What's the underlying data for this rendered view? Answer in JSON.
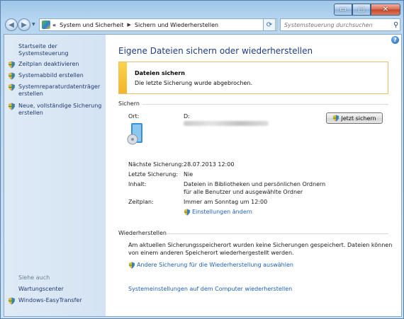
{
  "window": {
    "caption_buttons": {
      "minimize": "▭",
      "maximize": "▢",
      "close": "✕"
    }
  },
  "nav": {
    "breadcrumb": [
      "«",
      "System und Sicherheit",
      "Sichern und Wiederherstellen"
    ],
    "search_placeholder": "Systemsteuerung durchsuchen"
  },
  "sidebar": {
    "home_link": "Startseite der Systemsteuerung",
    "tasks": [
      {
        "label": "Zeitplan deaktivieren",
        "icon": "shield-icon"
      },
      {
        "label": "Systemabbild erstellen",
        "icon": "shield-icon"
      },
      {
        "label": "Systemreparaturdatenträger erstellen",
        "icon": "shield-icon"
      },
      {
        "label": "Neue, vollständige Sicherung erstellen",
        "icon": "shield-icon"
      }
    ],
    "see_also_heading": "Siehe auch",
    "see_also": [
      {
        "label": "Wartungscenter"
      },
      {
        "label": "Windows-EasyTransfer",
        "icon": "shield-icon"
      }
    ]
  },
  "main": {
    "title": "Eigene Dateien sichern oder wiederherstellen",
    "notice": {
      "heading": "Dateien sichern",
      "text": "Die letzte Sicherung wurde abgebrochen."
    },
    "backup": {
      "section": "Sichern",
      "location_label": "Ort:",
      "location_value": "D:",
      "backup_now_button": "Jetzt sichern",
      "next_label": "Nächste Sicherung:",
      "next_value": "28.07.2013 12:00",
      "last_label": "Letzte Sicherung:",
      "last_value": "Nie",
      "content_label": "Inhalt:",
      "content_value_line1": "Dateien in Bibliotheken und persönlichen Ordnern",
      "content_value_line2": "für alle Benutzer und ausgewählte Ordner",
      "schedule_label": "Zeitplan:",
      "schedule_value": "Immer am Sonntag um 12:00",
      "change_settings_link": "Einstellungen ändern"
    },
    "restore": {
      "section": "Wiederherstellen",
      "text": "Am aktuellen Sicherungsspeicherort wurden keine Sicherungen gespeichert. Dateien können von einem anderen Speicherort wiederhergestellt werden.",
      "other_backup_link": "Andere Sicherung für die Wiederherstellung auswählen",
      "system_restore_link": "Systemeinstellungen auf dem Computer wiederherstellen"
    }
  },
  "colors": {
    "link": "#1e5fb0",
    "title": "#1e3d85",
    "notice_bar": "#f2b42a",
    "sidebar_bg": "#d9e6f5"
  }
}
